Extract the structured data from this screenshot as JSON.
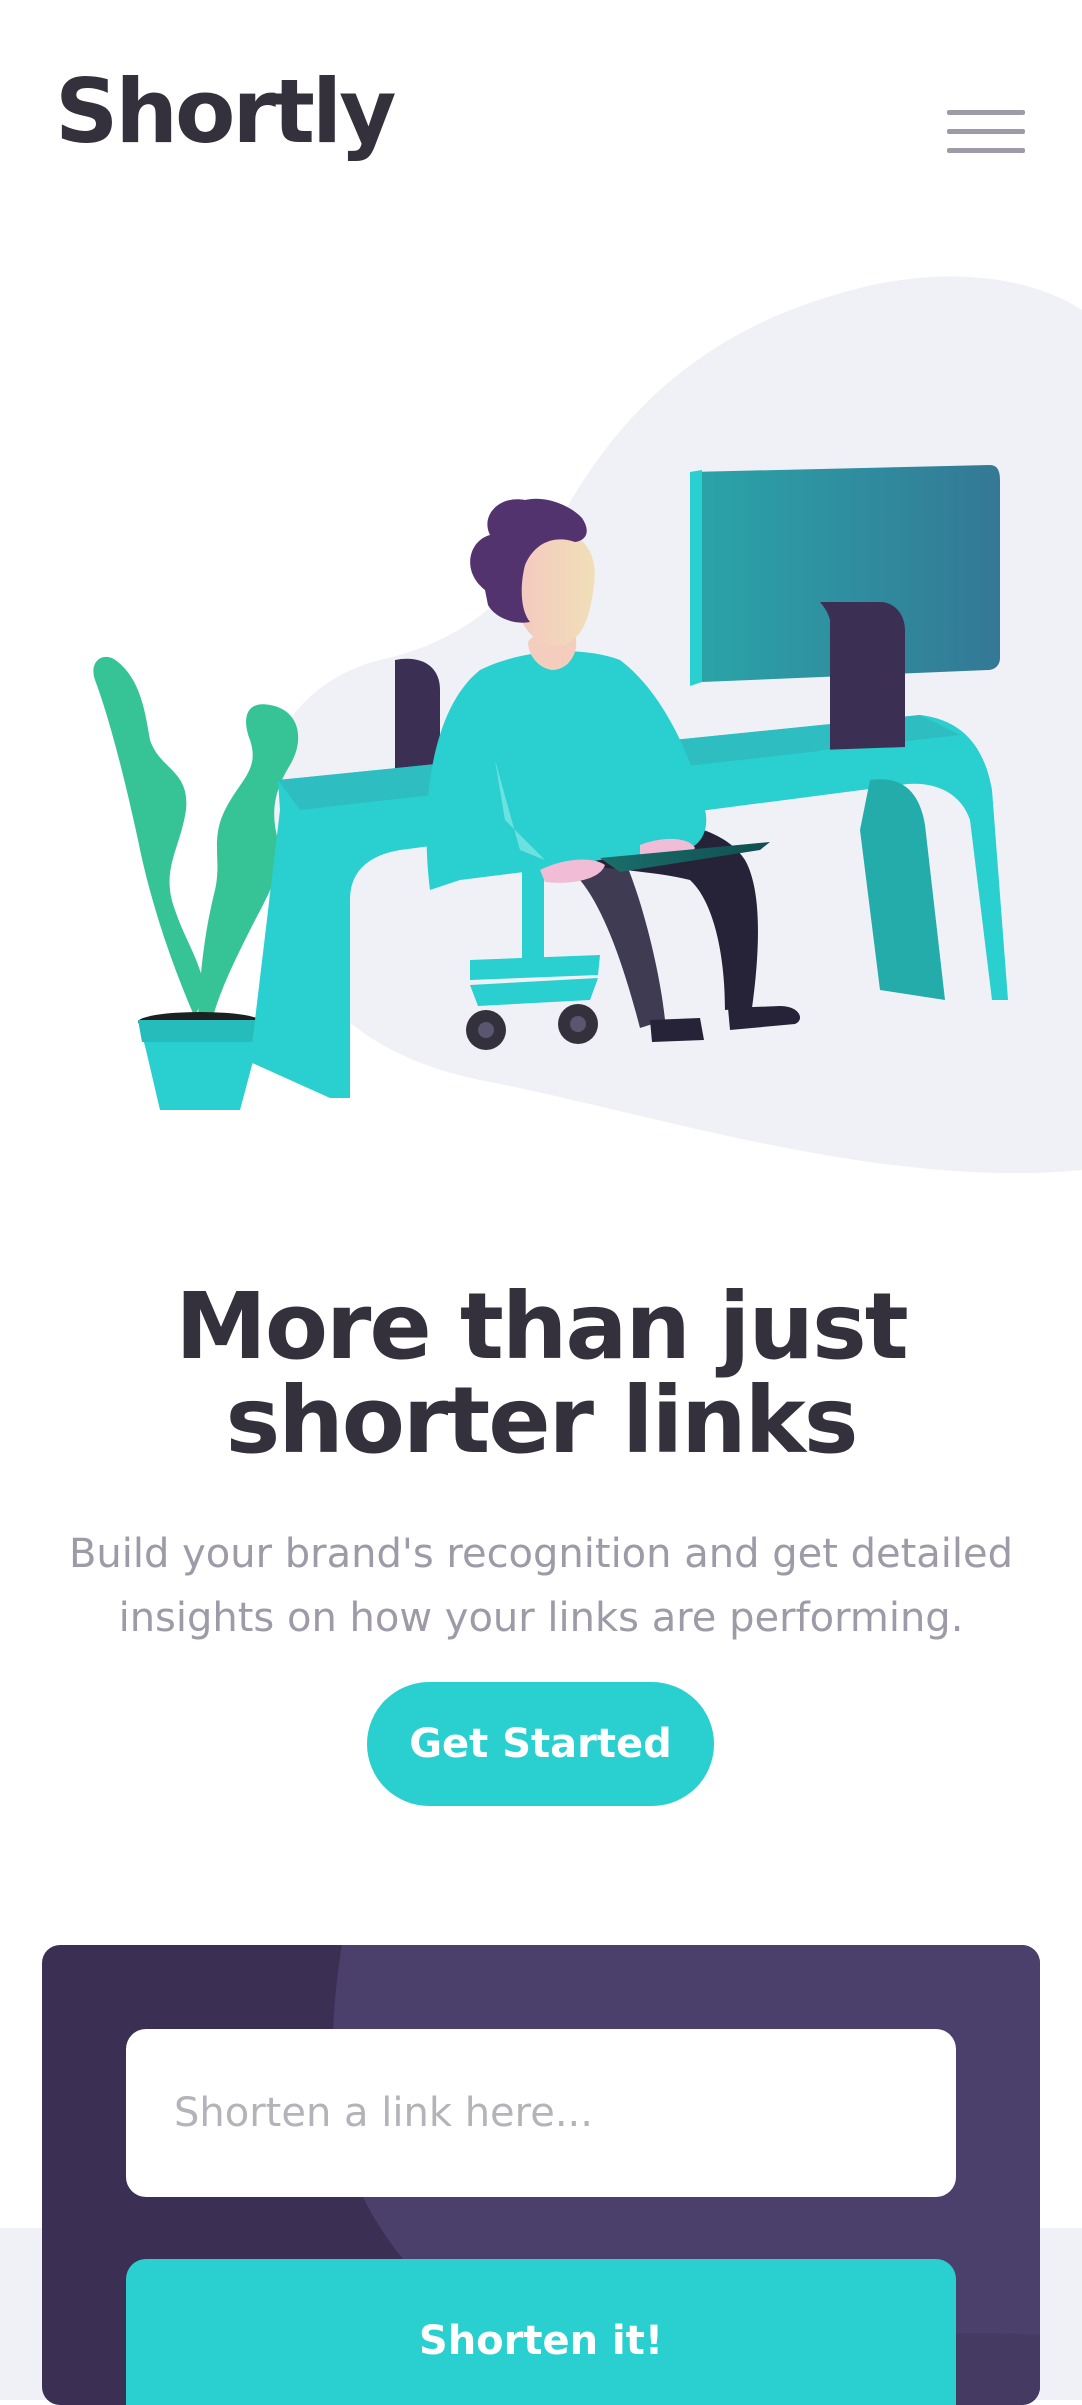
{
  "header": {
    "logo": "Shortly",
    "menu_icon": "hamburger-menu-icon"
  },
  "hero": {
    "illustration": "person-working-at-desk-illustration",
    "title_line1": "More than just",
    "title_line2": "shorter links",
    "subtitle_line1": "Build your brand's recognition and get detailed",
    "subtitle_line2": "insights on how your links are performing.",
    "cta_label": "Get Started"
  },
  "shorten": {
    "placeholder": "Shorten a link here...",
    "value": "",
    "button_label": "Shorten it!"
  },
  "colors": {
    "primary_cyan": "#2acfcf",
    "dark_violet": "#3b3054",
    "very_dark_blue": "#34313d",
    "grayish_violet": "#9e9aa7",
    "light_gray_bg": "#eff1f7"
  }
}
